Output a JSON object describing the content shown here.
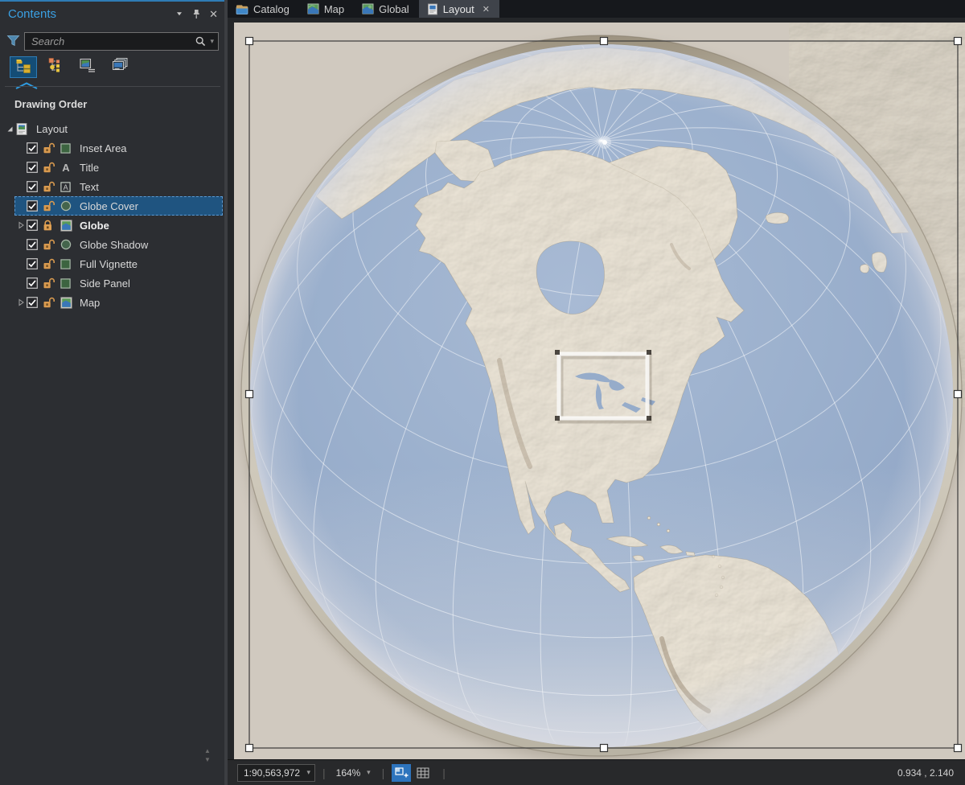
{
  "colors": {
    "accent_blue": "#3aa0e3",
    "selection_blue": "#1f5480",
    "panel_bg": "#2c2e32",
    "page_cream": "#d7d0c6",
    "ocean_blue": "#9cb0cd",
    "land_cream": "#e9e2d4",
    "graticule_white": "#ffffff",
    "lock_orange": "#d99a4f",
    "symbol_green": "#3c6440"
  },
  "contents_panel": {
    "title": "Contents",
    "search": {
      "placeholder": "Search"
    },
    "view_buttons": [
      {
        "name": "list-by-drawing-order",
        "selected": true
      },
      {
        "name": "list-by-element-type",
        "selected": false
      },
      {
        "name": "list-by-map-view",
        "selected": false
      },
      {
        "name": "list-by-slides",
        "selected": false
      }
    ],
    "section_label": "Drawing Order",
    "tree": [
      {
        "label": "Layout",
        "kind": "layout",
        "expander": "expanded",
        "indent": 0
      },
      {
        "label": "Inset Area",
        "kind": "square",
        "checked": true,
        "lock": "unlocked",
        "indent": 1
      },
      {
        "label": "Title",
        "kind": "text-a",
        "checked": true,
        "lock": "unlocked",
        "indent": 1
      },
      {
        "label": "Text",
        "kind": "text-box",
        "checked": true,
        "lock": "unlocked",
        "indent": 1
      },
      {
        "label": "Globe Cover",
        "kind": "circle",
        "checked": true,
        "lock": "unlocked",
        "indent": 1,
        "selected": true
      },
      {
        "label": "Globe",
        "kind": "mapframe",
        "checked": true,
        "lock": "locked",
        "indent": 1,
        "expander": "collapsed",
        "bold": true
      },
      {
        "label": "Globe Shadow",
        "kind": "circle",
        "checked": true,
        "lock": "unlocked",
        "indent": 1
      },
      {
        "label": "Full Vignette",
        "kind": "square",
        "checked": true,
        "lock": "unlocked",
        "indent": 1
      },
      {
        "label": "Side Panel",
        "kind": "square",
        "checked": true,
        "lock": "unlocked",
        "indent": 1
      },
      {
        "label": "Map",
        "kind": "mapframe",
        "checked": true,
        "lock": "unlocked",
        "indent": 1,
        "expander": "collapsed"
      }
    ]
  },
  "tabs": [
    {
      "label": "Catalog",
      "icon": "catalog-icon",
      "active": false
    },
    {
      "label": "Map",
      "icon": "map-icon",
      "active": false
    },
    {
      "label": "Global",
      "icon": "globe-icon",
      "active": false
    },
    {
      "label": "Layout",
      "icon": "layout-icon",
      "active": true,
      "closable": true
    }
  ],
  "statusbar": {
    "scale": "1:90,563,972",
    "zoom": "164%",
    "coordinates": "0.934 , 2.140",
    "buttons": [
      {
        "name": "layout-snapping-toggle",
        "active": true
      },
      {
        "name": "grid-toggle",
        "active": false
      }
    ]
  }
}
